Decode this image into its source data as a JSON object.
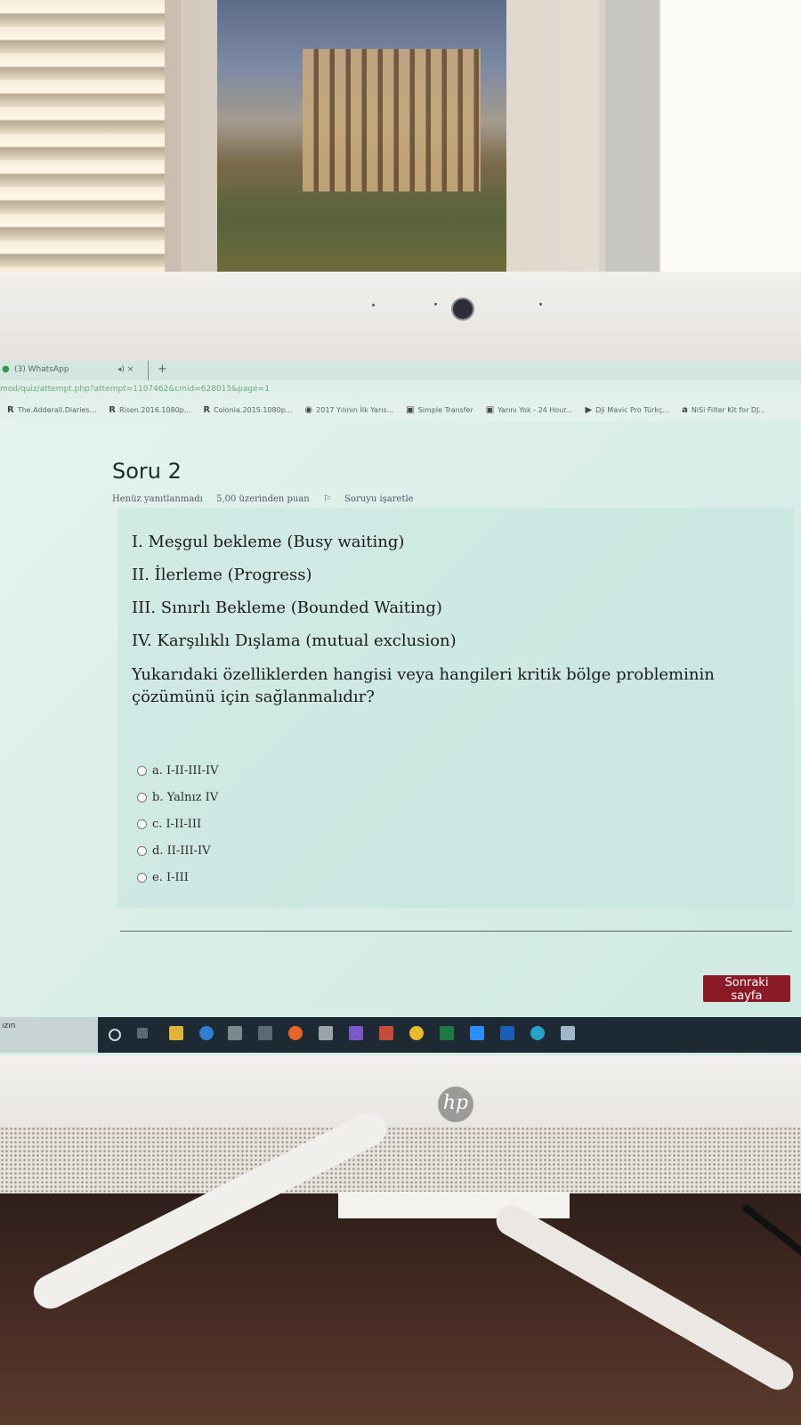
{
  "browser": {
    "tab_title": "(3) WhatsApp",
    "tab_controls": "◂) ×",
    "new_tab": "+",
    "url": "mod/quiz/attempt.php?attempt=1107462&cmid=628015&page=1",
    "bookmarks": [
      {
        "icon": "R",
        "label": "The.Adderall.Diaries..."
      },
      {
        "icon": "R",
        "label": "Risen.2016.1080p..."
      },
      {
        "icon": "R",
        "label": "Colonia.2015.1080p..."
      },
      {
        "icon": "◉",
        "label": "2017 Yılının İlk Yarıs..."
      },
      {
        "icon": "▣",
        "label": "Simple Transfer"
      },
      {
        "icon": "▣",
        "label": "Yarını Yok - 24 Hour..."
      },
      {
        "icon": "▶",
        "label": "Dji Mavic Pro Türkç..."
      },
      {
        "icon": "a",
        "label": "NiSi Filter Kit for DJ..."
      }
    ]
  },
  "quiz": {
    "title": "Soru 2",
    "status": "Henüz yanıtlanmadı",
    "points": "5,00 üzerinden puan",
    "flag": "Soruyu işaretle",
    "statements": [
      "I. Meşgul bekleme (Busy waiting)",
      "II. İlerleme (Progress)",
      "III. Sınırlı Bekleme (Bounded Waiting)",
      "IV. Karşılıklı Dışlama (mutual exclusion)"
    ],
    "question": "Yukarıdaki özelliklerden hangisi veya hangileri kritik bölge probleminin çözümünü için sağlanmalıdır?",
    "options": [
      "a. I-II-III-IV",
      "b. Yalnız IV",
      "c. I-II-III",
      "d. II-III-IV",
      "e. I-III"
    ],
    "next_button": "Sonraki sayfa"
  },
  "taskbar": {
    "search_stub": "ızın"
  },
  "monitor": {
    "brand": "hp"
  },
  "colors": {
    "next_button": "#8a1a26",
    "screen_bg": "#dcefe9",
    "taskbar": "#1e2a33"
  }
}
